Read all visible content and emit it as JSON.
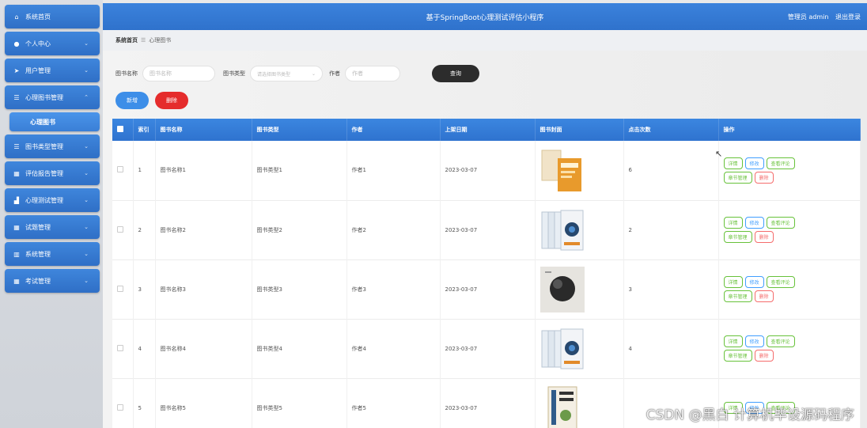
{
  "sidebar": {
    "items": [
      {
        "label": "系统首页",
        "icon": "home-icon",
        "chevron": false
      },
      {
        "label": "个人中心",
        "icon": "user-icon",
        "chevron": true
      },
      {
        "label": "用户管理",
        "icon": "send-icon",
        "chevron": true
      },
      {
        "label": "心理图书管理",
        "icon": "list-icon",
        "chevron": true
      },
      {
        "label": "心理图书",
        "icon": "",
        "chevron": false,
        "sub": true
      },
      {
        "label": "图书类型管理",
        "icon": "list-icon",
        "chevron": true
      },
      {
        "label": "评估报告管理",
        "icon": "grid-icon",
        "chevron": true
      },
      {
        "label": "心理测试管理",
        "icon": "chart-icon",
        "chevron": true
      },
      {
        "label": "试题管理",
        "icon": "grid-icon",
        "chevron": true
      },
      {
        "label": "系统管理",
        "icon": "bars-icon",
        "chevron": true
      },
      {
        "label": "考试管理",
        "icon": "grid-icon",
        "chevron": true
      }
    ]
  },
  "header": {
    "title": "基于SpringBoot心理测试评估小程序",
    "user": "管理员 admin",
    "logout": "退出登录"
  },
  "breadcrumb": {
    "home": "系统首页",
    "separator": "☰",
    "current": "心理图书"
  },
  "search": {
    "name_label": "图书名称",
    "name_placeholder": "图书名称",
    "type_label": "图书类型",
    "type_placeholder": "请选择图书类型",
    "author_label": "作者",
    "author_placeholder": "作者",
    "query_button": "查询"
  },
  "toolbar": {
    "add_label": "新增",
    "delete_label": "删除"
  },
  "table": {
    "headers": [
      "索引",
      "图书名称",
      "图书类型",
      "作者",
      "上架日期",
      "图书封面",
      "点击次数",
      "操作"
    ],
    "rows": [
      {
        "index": "1",
        "name": "图书名称1",
        "type": "图书类型1",
        "author": "作者1",
        "date": "2023-03-07",
        "clicks": "6"
      },
      {
        "index": "2",
        "name": "图书名称2",
        "type": "图书类型2",
        "author": "作者2",
        "date": "2023-03-07",
        "clicks": "2"
      },
      {
        "index": "3",
        "name": "图书名称3",
        "type": "图书类型3",
        "author": "作者3",
        "date": "2023-03-07",
        "clicks": "3"
      },
      {
        "index": "4",
        "name": "图书名称4",
        "type": "图书类型4",
        "author": "作者4",
        "date": "2023-03-07",
        "clicks": "4"
      },
      {
        "index": "5",
        "name": "图书名称5",
        "type": "图书类型5",
        "author": "作者5",
        "date": "2023-03-07",
        "clicks": ""
      }
    ],
    "ops": {
      "detail": "详情",
      "edit": "修改",
      "comments": "查看评论",
      "chapter": "章节管理",
      "delete": "删除"
    }
  },
  "watermark": "CSDN @黑白   计算机毕设源码程序",
  "colors": {
    "primary": "#3b82dc",
    "danger": "#e52c2c",
    "success": "#67c23a",
    "edit": "#409eff"
  }
}
